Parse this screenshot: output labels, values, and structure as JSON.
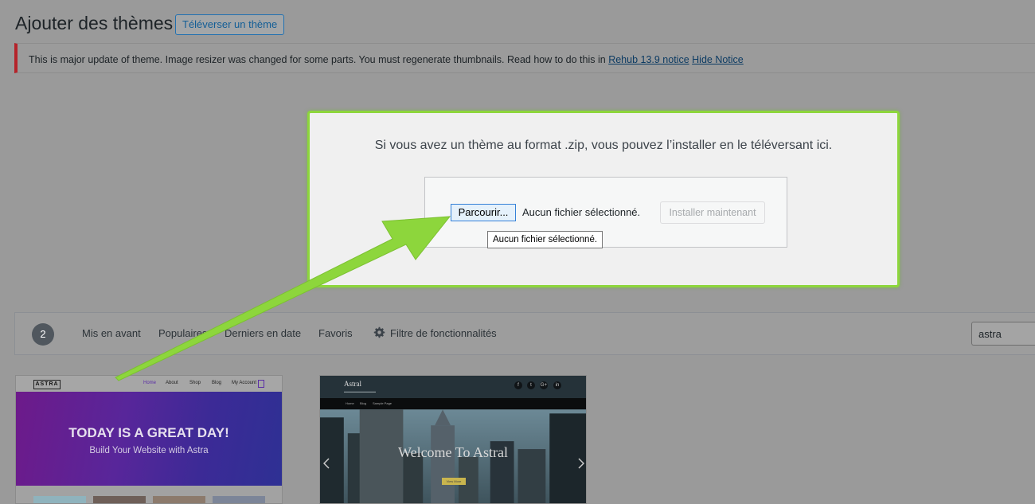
{
  "header": {
    "title": "Ajouter des thèmes",
    "upload_button": "Téléverser un thème"
  },
  "notice": {
    "text": "This is major update of theme. Image resizer was changed for some parts. You must regenerate thumbnails. Read how to do this in",
    "link1": "Rehub 13.9 notice",
    "link2": "Hide Notice",
    "accent_color": "#b5232a"
  },
  "upload": {
    "instruction": "Si vous avez un thème au format .zip, vous pouvez l’installer en le téléversant ici.",
    "browse_label": "Parcourir...",
    "file_status": "Aucun fichier sélectionné.",
    "install_label": "Installer maintenant",
    "tooltip": "Aucun fichier sélectionné.",
    "highlight_color": "#8dd63c"
  },
  "filter": {
    "count": "2",
    "links": [
      "Mis en avant",
      "Populaires",
      "Derniers en date",
      "Favoris"
    ],
    "feature_filter": "Filtre de fonctionnalités",
    "feature_filter_icon": "gear-icon",
    "search_value": "astra"
  },
  "themes": {
    "astra": {
      "logo": "ASTRA",
      "menu": [
        "Home",
        "About",
        "Shop",
        "Blog",
        "My Account"
      ],
      "headline": "TODAY IS A GREAT DAY!",
      "subheadline": "Build Your Website with Astra"
    },
    "astral": {
      "title": "Astral",
      "social": [
        "f",
        "t",
        "G+",
        "in"
      ],
      "menu": [
        "Home",
        "Blog",
        "Sample Page"
      ],
      "headline": "Welcome To Astral",
      "button": "View More"
    }
  }
}
